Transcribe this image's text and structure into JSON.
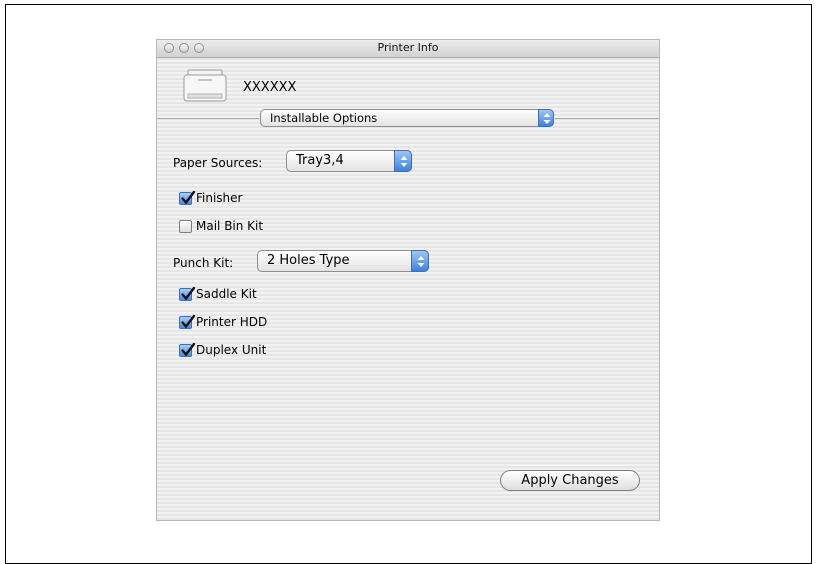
{
  "window": {
    "title": "Printer Info"
  },
  "printer": {
    "name": "XXXXXX"
  },
  "section_popup": {
    "value": "Installable Options"
  },
  "paper_sources": {
    "label": "Paper Sources:",
    "value": "Tray3,4"
  },
  "punch_kit": {
    "label": "Punch Kit:",
    "value": "2 Holes Type"
  },
  "options": [
    {
      "label": "Finisher",
      "checked": true
    },
    {
      "label": "Mail Bin Kit",
      "checked": false
    },
    {
      "label": "Saddle Kit",
      "checked": true
    },
    {
      "label": "Printer HDD",
      "checked": true
    },
    {
      "label": "Duplex Unit",
      "checked": true
    }
  ],
  "buttons": {
    "apply": "Apply Changes"
  },
  "icons": {
    "printer": "printer-icon",
    "popup_arrows": "up-down-arrows-icon",
    "checkmark": "checkmark-icon"
  },
  "colors": {
    "accent": "#3f82dc"
  }
}
